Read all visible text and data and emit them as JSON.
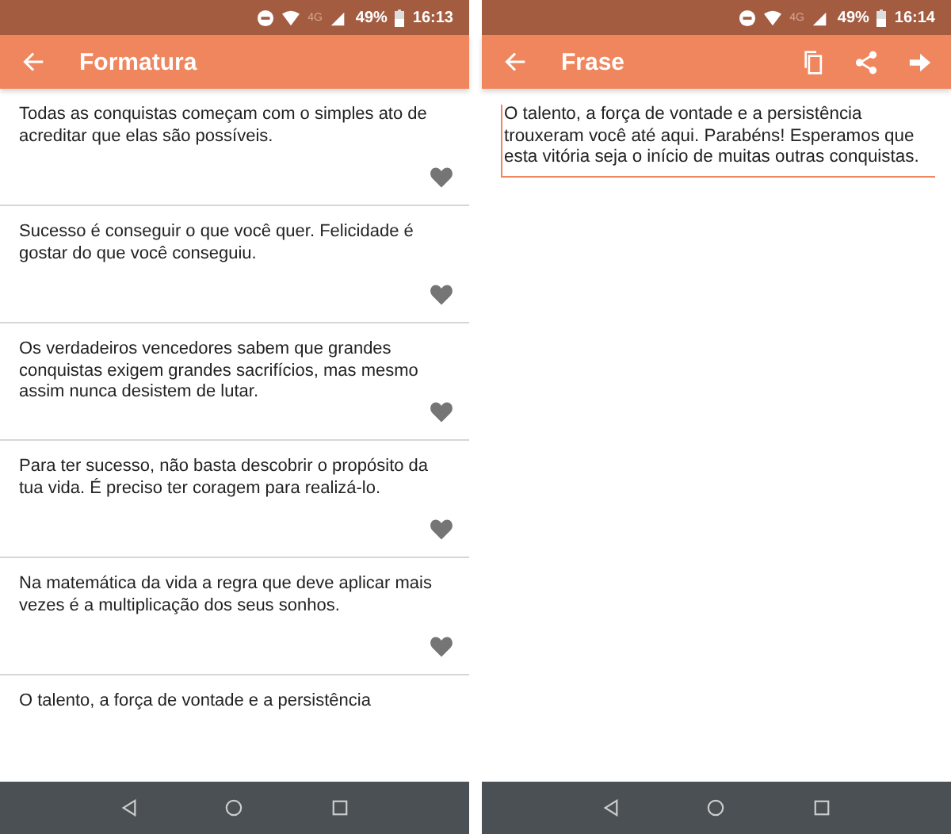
{
  "screens": [
    {
      "status_bar": {
        "battery": "49%",
        "time": "16:13",
        "network": "4G"
      },
      "app_bar": {
        "title": "Formatura"
      },
      "quotes": [
        {
          "text": "Todas as conquistas começam com o simples ato de acreditar que elas são possíveis.",
          "favorite": false
        },
        {
          "text": "Sucesso é conseguir o que você quer. Felicidade é gostar do que você conseguiu.",
          "favorite": false
        },
        {
          "text": "Os verdadeiros vencedores sabem que grandes conquistas exigem grandes sacrifícios, mas mesmo assim nunca desistem de lutar.",
          "favorite": false
        },
        {
          "text": "Para ter sucesso, não basta descobrir o propósito da tua vida. É preciso ter coragem para realizá-lo.",
          "favorite": false
        },
        {
          "text": "Na matemática da vida a regra que deve aplicar mais vezes é a multiplicação dos seus sonhos.",
          "favorite": false
        },
        {
          "text": "O talento, a força de vontade e a persistência"
        }
      ]
    },
    {
      "status_bar": {
        "battery": "49%",
        "time": "16:14",
        "network": "4G"
      },
      "app_bar": {
        "title": "Frase",
        "actions": [
          {
            "kind": "copy"
          },
          {
            "kind": "share"
          },
          {
            "kind": "forward"
          }
        ]
      },
      "editor": {
        "value": "O talento, a força de vontade e a persistência trouxeram você até aqui. Parabéns! Esperamos que esta vitória seja o início de muitas outras conquistas."
      }
    }
  ]
}
